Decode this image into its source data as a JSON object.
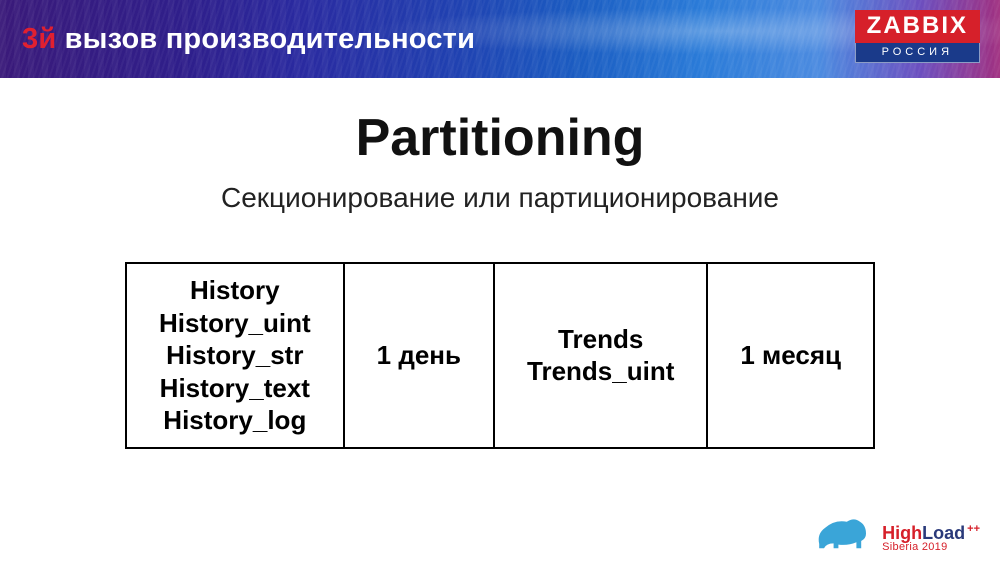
{
  "header": {
    "number": "3й",
    "title": "вызов производительности",
    "logo_top": "ZABBIX",
    "logo_bottom": "РОССИЯ"
  },
  "main": {
    "title": "Partitioning",
    "subtitle": "Секционирование или партиционирование"
  },
  "table": {
    "col1": [
      "History",
      "History_uint",
      "History_str",
      "History_text",
      "History_log"
    ],
    "col2": "1 день",
    "col3": [
      "Trends",
      "Trends_uint"
    ],
    "col4": "1 месяц"
  },
  "footer": {
    "brand_high": "High",
    "brand_load": "Load",
    "brand_plus": "++",
    "brand_sub": "Siberia 2019"
  }
}
